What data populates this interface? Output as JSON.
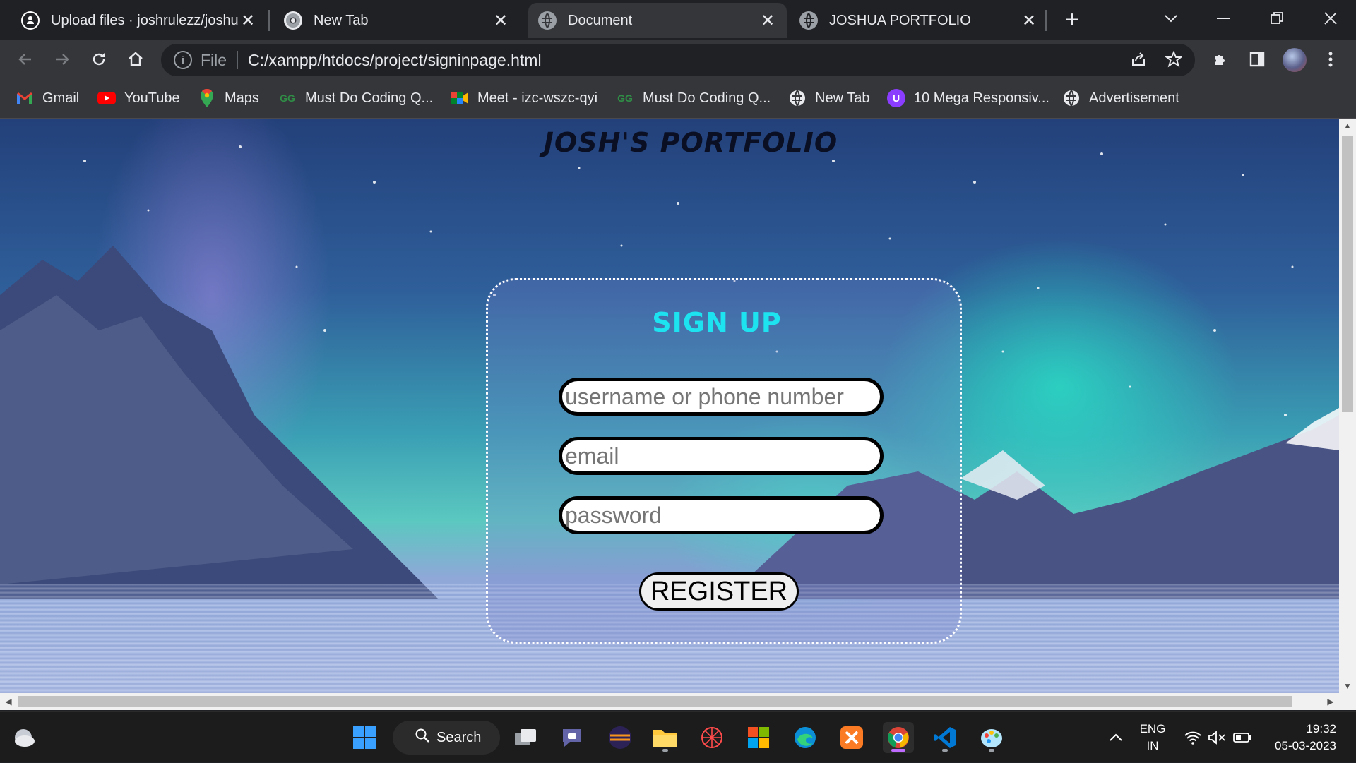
{
  "tabs": [
    {
      "title": "Upload files · joshrulezz/joshua",
      "favicon": "github-icon",
      "active": false
    },
    {
      "title": "New Tab",
      "favicon": "chrome-icon",
      "active": false
    },
    {
      "title": "Document",
      "favicon": "globe-icon",
      "active": true
    },
    {
      "title": "JOSHUA PORTFOLIO",
      "favicon": "globe-icon",
      "active": false
    }
  ],
  "omnibox": {
    "scheme": "File",
    "url": "C:/xampp/htdocs/project/signinpage.html"
  },
  "bookmarks": [
    {
      "label": "Gmail",
      "icon": "gmail-icon"
    },
    {
      "label": "YouTube",
      "icon": "youtube-icon"
    },
    {
      "label": "Maps",
      "icon": "maps-icon"
    },
    {
      "label": "Must Do Coding Q...",
      "icon": "gfg-icon"
    },
    {
      "label": "Meet - izc-wszc-qyi",
      "icon": "meet-icon"
    },
    {
      "label": "Must Do Coding Q...",
      "icon": "gfg-icon"
    },
    {
      "label": "New Tab",
      "icon": "globe-icon"
    },
    {
      "label": "10 Mega Responsiv...",
      "icon": "purple-app-icon"
    },
    {
      "label": "Advertisement",
      "icon": "globe-icon"
    }
  ],
  "page": {
    "title": "JOSH'S PORTFOLIO",
    "form": {
      "heading": "SIGN UP",
      "username_placeholder": "username or phone number",
      "email_placeholder": "email",
      "password_placeholder": "password",
      "submit_label": "REGISTER"
    }
  },
  "taskbar": {
    "search_label": "Search",
    "language": "ENG",
    "region": "IN",
    "time": "19:32",
    "date": "05-03-2023"
  },
  "colors": {
    "form_heading": "#1de3f0",
    "page_title": "#0a0f24",
    "chrome_dark": "#202124",
    "chrome_toolbar": "#35363a"
  }
}
